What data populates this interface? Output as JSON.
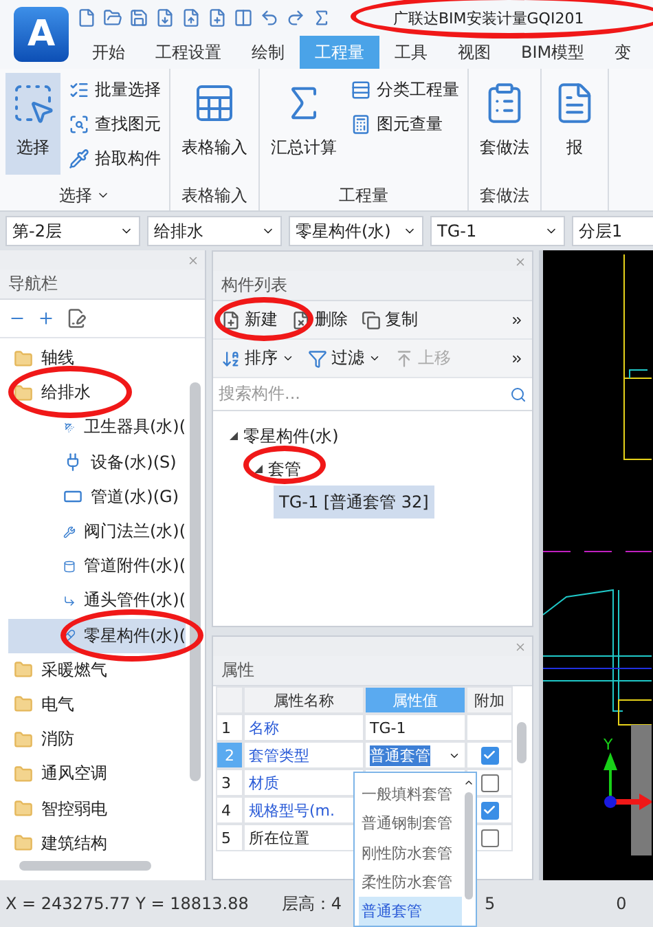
{
  "app": {
    "logo": "A",
    "title": "广联达BIM安装计量GQI201"
  },
  "tabs": [
    {
      "label": "开始",
      "selected": false
    },
    {
      "label": "工程设置",
      "selected": false
    },
    {
      "label": "绘制",
      "selected": false
    },
    {
      "label": "工程量",
      "selected": true
    },
    {
      "label": "工具",
      "selected": false
    },
    {
      "label": "视图",
      "selected": false
    },
    {
      "label": "BIM模型",
      "selected": false
    },
    {
      "label": "变",
      "selected": false
    }
  ],
  "ribbon": {
    "groups": [
      {
        "label": "选择",
        "has_menu": true,
        "items": [
          {
            "label": "选择",
            "kind": "large",
            "pressed": true
          },
          {
            "label": "批量选择",
            "kind": "small",
            "pressed": false
          },
          {
            "label": "查找图元",
            "kind": "small",
            "pressed": false
          },
          {
            "label": "拾取构件",
            "kind": "small",
            "pressed": false
          }
        ]
      },
      {
        "label": "表格输入",
        "has_menu": false,
        "items": [
          {
            "label": "表格输入",
            "kind": "large",
            "pressed": false
          }
        ]
      },
      {
        "label": "工程量",
        "has_menu": false,
        "items": [
          {
            "label": "汇总计算",
            "kind": "large",
            "pressed": false
          },
          {
            "label": "分类工程量",
            "kind": "small",
            "pressed": false
          },
          {
            "label": "图元查量",
            "kind": "small",
            "pressed": false
          }
        ]
      },
      {
        "label": "套做法",
        "has_menu": false,
        "items": [
          {
            "label": "套做法",
            "kind": "large",
            "pressed": false
          }
        ]
      },
      {
        "items": [
          {
            "label": "报",
            "kind": "large",
            "pressed": false
          }
        ]
      }
    ]
  },
  "selectors": [
    {
      "value": "第-2层"
    },
    {
      "value": "给排水"
    },
    {
      "value": "零星构件(水)"
    },
    {
      "value": "TG-1"
    },
    {
      "value": "分层1"
    }
  ],
  "nav": {
    "title": "导航栏",
    "tree": [
      {
        "label": "轴线",
        "selected": false
      },
      {
        "label": "给排水",
        "selected": false,
        "children": [
          {
            "label": "卫生器具(水)(",
            "selected": false
          },
          {
            "label": "设备(水)(S)",
            "selected": false
          },
          {
            "label": "管道(水)(G)",
            "selected": false
          },
          {
            "label": "阀门法兰(水)(",
            "selected": false
          },
          {
            "label": "管道附件(水)(",
            "selected": false
          },
          {
            "label": "通头管件(水)(",
            "selected": false
          },
          {
            "label": "零星构件(水)(",
            "selected": true
          }
        ]
      },
      {
        "label": "采暖燃气",
        "selected": false
      },
      {
        "label": "电气",
        "selected": false
      },
      {
        "label": "消防",
        "selected": false
      },
      {
        "label": "通风空调",
        "selected": false
      },
      {
        "label": "智控弱电",
        "selected": false
      },
      {
        "label": "建筑结构",
        "selected": false
      }
    ]
  },
  "component_list": {
    "title": "构件列表",
    "toolbar": [
      {
        "label": "新建",
        "disabled": false
      },
      {
        "label": "删除",
        "disabled": false
      },
      {
        "label": "复制",
        "disabled": false
      }
    ],
    "toolbar2": [
      {
        "label": "排序",
        "has_menu": true,
        "disabled": false
      },
      {
        "label": "过滤",
        "has_menu": true,
        "disabled": false
      },
      {
        "label": "上移",
        "has_menu": false,
        "disabled": true
      }
    ],
    "search": {
      "placeholder": "搜索构件..."
    },
    "tree": [
      {
        "label": "零星构件(水)",
        "expanded": true,
        "selected": false,
        "children": [
          {
            "label": "套管",
            "expanded": true,
            "selected": false,
            "children": [
              {
                "label": "TG-1 [普通套管 32]",
                "selected": true
              }
            ]
          }
        ]
      }
    ]
  },
  "properties": {
    "title": "属性",
    "columns": [
      {
        "label": "属性名称",
        "selected": false
      },
      {
        "label": "属性值",
        "selected": true
      },
      {
        "label": "附加",
        "selected": false
      }
    ],
    "rows": [
      {
        "index": "1",
        "name": "名称",
        "value": "TG-1",
        "public": true,
        "selected": false,
        "attached": null
      },
      {
        "index": "2",
        "name": "套管类型",
        "value": "普通套管",
        "public": true,
        "selected": true,
        "attached": true
      },
      {
        "index": "3",
        "name": "材质",
        "public": true,
        "selected": false,
        "attached": false
      },
      {
        "index": "4",
        "name": "规格型号(m.",
        "public": true,
        "selected": false,
        "attached": true
      },
      {
        "index": "5",
        "name": "所在位置",
        "public": false,
        "selected": false,
        "attached": false
      }
    ]
  },
  "dropdown": {
    "items": [
      {
        "label": "一般填料套管",
        "selected": false
      },
      {
        "label": "普通钢制套管",
        "selected": false
      },
      {
        "label": "刚性防水套管",
        "selected": false
      },
      {
        "label": "柔性防水套管",
        "selected": false
      },
      {
        "label": "普通套管",
        "selected": true
      }
    ]
  },
  "canvas": {
    "axis_label": "Y"
  },
  "status_bar": {
    "coords": "X = 243275.77 Y = 18813.88",
    "floor_height": "层高：4",
    "field_3": "5",
    "field_4": "0"
  }
}
